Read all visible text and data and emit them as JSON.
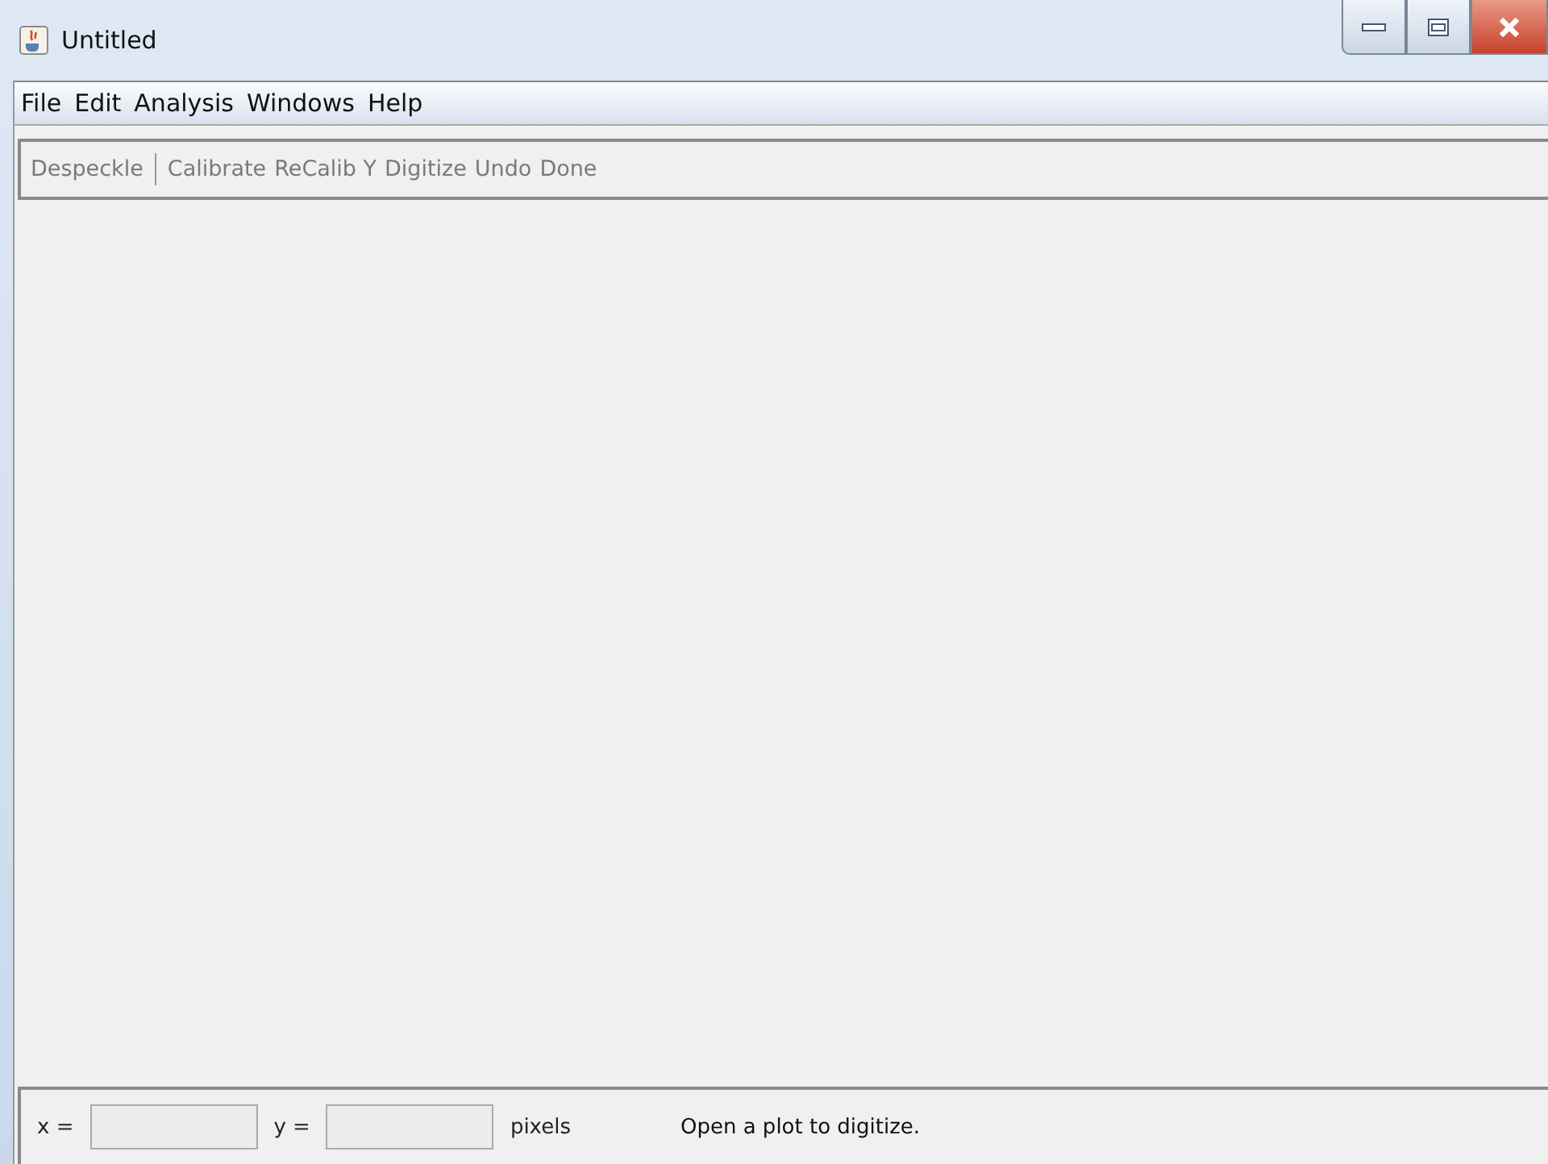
{
  "window": {
    "title": "Untitled"
  },
  "menu": [
    "File",
    "Edit",
    "Analysis",
    "Windows",
    "Help"
  ],
  "toolbar": [
    {
      "kind": "button",
      "label": "Despeckle",
      "disabled": true
    },
    {
      "kind": "separator"
    },
    {
      "kind": "button",
      "label": "Calibrate",
      "disabled": true
    },
    {
      "kind": "button",
      "label": "ReCalib Y",
      "disabled": true
    },
    {
      "kind": "button",
      "label": "Digitize",
      "disabled": true
    },
    {
      "kind": "button",
      "label": "Undo",
      "disabled": true
    },
    {
      "kind": "button",
      "label": "Done",
      "disabled": true
    }
  ],
  "status_bar": {
    "x_label": "x =",
    "y_label": "y =",
    "unit": "pixels",
    "message": "Open a plot to digitize."
  }
}
